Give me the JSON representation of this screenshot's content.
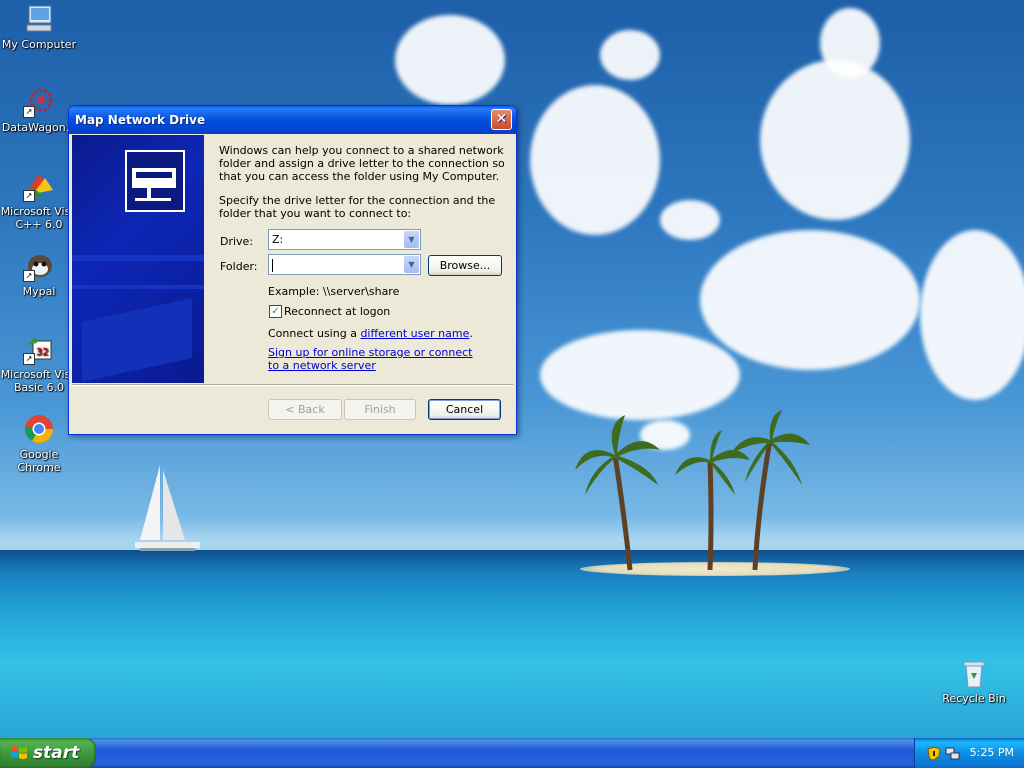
{
  "desktop": {
    "icons": [
      {
        "label": "My Computer",
        "icon": "computer-icon"
      },
      {
        "label": "DataWagon...",
        "icon": "datawagon-icon"
      },
      {
        "label": "Microsoft Visu C++ 6.0",
        "icon": "visual-cpp-icon"
      },
      {
        "label": "Mypal",
        "icon": "mypal-icon"
      },
      {
        "label": "Microsoft Visu Basic 6.0",
        "icon": "visual-basic-icon"
      },
      {
        "label": "Google Chrome",
        "icon": "chrome-icon"
      },
      {
        "label": "Recycle Bin",
        "icon": "recycle-bin-icon"
      }
    ]
  },
  "dialog": {
    "title": "Map Network Drive",
    "close_glyph": "✕",
    "intro": "Windows can help you connect to a shared network folder and assign a drive letter to the connection so that you can access the folder using My Computer.",
    "instruction": "Specify the drive letter for the connection and the folder that you want to connect to:",
    "drive_label": "Drive:",
    "drive_value": "Z:",
    "folder_label": "Folder:",
    "folder_value": "",
    "browse_label": "Browse...",
    "example": "Example: \\\\server\\share",
    "reconnect_label": "Reconnect at logon",
    "reconnect_checked": true,
    "connect_using_prefix": "Connect using a ",
    "different_user_link": "different user name",
    "connect_using_suffix": ".",
    "signup_link": "Sign up for online storage or connect to a network server",
    "back_label": "< Back",
    "finish_label": "Finish",
    "cancel_label": "Cancel"
  },
  "taskbar": {
    "start_label": "start",
    "clock": "5:25 PM"
  },
  "colors": {
    "title_bar": "#0553e1",
    "side_panel": "#0d26b5",
    "dialog_bg": "#ece9d8",
    "start_green": "#3a923a",
    "taskbar_blue": "#2157d7"
  }
}
